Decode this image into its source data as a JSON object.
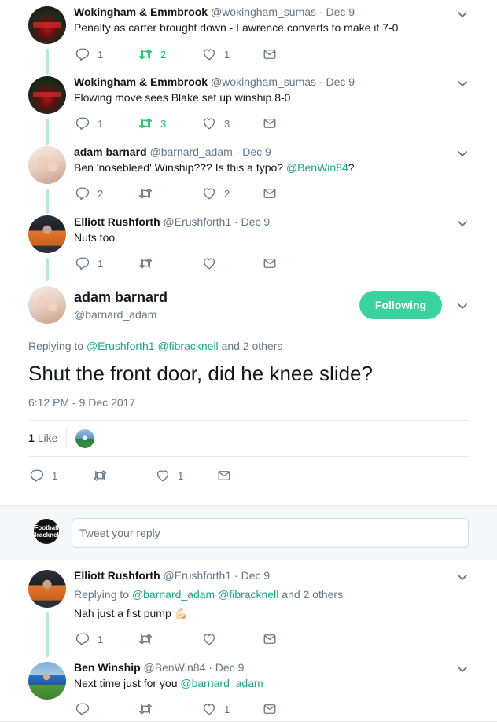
{
  "tweets": [
    {
      "name": "Wokingham & Emmbrook",
      "handle": "@wokingham_sumas",
      "date": "· Dec 9",
      "text": "Penalty as carter brought down - Lawrence converts to make it 7-0",
      "replies": "1",
      "retweets": "2",
      "likes": "1"
    },
    {
      "name": "Wokingham & Emmbrook",
      "handle": "@wokingham_sumas",
      "date": "· Dec 9",
      "text": "Flowing move sees Blake set up winship 8-0",
      "replies": "1",
      "retweets": "3",
      "likes": "3"
    },
    {
      "name": "adam barnard",
      "handle": "@barnard_adam",
      "date": "· Dec 9",
      "text_prefix": "Ben 'nosebleed' Winship??? Is this a typo? ",
      "text_mention": "@BenWin84",
      "text_suffix": "?",
      "replies": "2",
      "retweets": "",
      "likes": "2"
    },
    {
      "name": "Elliott Rushforth",
      "handle": "@Erushforth1",
      "date": "· Dec 9",
      "text": "Nuts too",
      "replies": "1",
      "retweets": "",
      "likes": ""
    }
  ],
  "main": {
    "name": "adam barnard",
    "handle": "@barnard_adam",
    "follow_label": "Following",
    "replying_to": "Replying to",
    "mention1": "@Erushforth1",
    "mention2": "@fibracknell",
    "and_others": "and 2 others",
    "text": "Shut the front door, did he knee slide?",
    "timestamp": "6:12 PM - 9 Dec 2017",
    "like_count": "1",
    "like_label": "Like",
    "replies": "1",
    "retweets": "",
    "likes": "1"
  },
  "reply_box": {
    "avatar_text_1": "Football",
    "avatar_text_2": "Bracknell",
    "placeholder": "Tweet your reply"
  },
  "replies": [
    {
      "name": "Elliott Rushforth",
      "handle": "@Erushforth1",
      "date": "· Dec 9",
      "replying_to": "Replying to",
      "mention1": "@barnard_adam",
      "mention2": "@fibracknell",
      "and_others": "and 2 others",
      "text": "Nah just a fist pump",
      "emoji": "💪🏻",
      "replies": "1",
      "retweets": "",
      "likes": ""
    },
    {
      "name": "Ben Winship",
      "handle": "@BenWin84",
      "date": "· Dec 9",
      "text_prefix": "Next time just for you ",
      "text_mention": "@barnard_adam",
      "replies": "",
      "retweets": "",
      "likes": "1"
    }
  ],
  "colors": {
    "accent": "#1aa684",
    "follow_bg": "#3ad3a0",
    "retweet_active": "#17bf63",
    "thread_line": "#b3ead9",
    "meta_gray": "#657786"
  }
}
